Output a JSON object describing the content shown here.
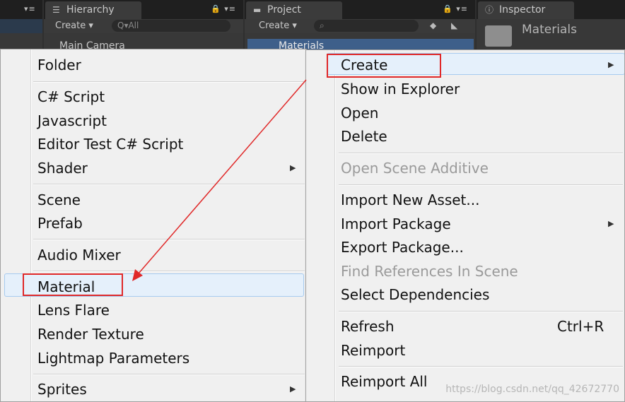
{
  "panels": {
    "hierarchy": {
      "tab": "Hierarchy",
      "create": "Create ▾",
      "search": "Q▾All",
      "visible_item": "Main Camera"
    },
    "project": {
      "tab": "Project",
      "create": "Create ▾",
      "folder": "Materials"
    },
    "inspector": {
      "tab": "Inspector",
      "title": "Materials"
    },
    "lock_menu": "🔒 ▾≡"
  },
  "context_menu": {
    "items": [
      {
        "label": "Create",
        "has_submenu": true,
        "highlighted": true
      },
      {
        "label": "Show in Explorer"
      },
      {
        "label": "Open"
      },
      {
        "label": "Delete"
      },
      {
        "label": "Open Scene Additive",
        "disabled": true
      },
      {
        "label": "Import New Asset..."
      },
      {
        "label": "Import Package",
        "has_submenu": true
      },
      {
        "label": "Export Package..."
      },
      {
        "label": "Find References In Scene",
        "disabled": true
      },
      {
        "label": "Select Dependencies"
      },
      {
        "label": "Refresh",
        "shortcut": "Ctrl+R"
      },
      {
        "label": "Reimport"
      },
      {
        "label": "Reimport All"
      }
    ]
  },
  "create_submenu": {
    "items": [
      {
        "label": "Folder"
      },
      {
        "label": "C# Script"
      },
      {
        "label": "Javascript"
      },
      {
        "label": "Editor Test C# Script"
      },
      {
        "label": "Shader",
        "has_submenu": true
      },
      {
        "label": "Scene"
      },
      {
        "label": "Prefab"
      },
      {
        "label": "Audio Mixer"
      },
      {
        "label": "Material",
        "highlighted": true
      },
      {
        "label": "Lens Flare"
      },
      {
        "label": "Render Texture"
      },
      {
        "label": "Lightmap Parameters"
      },
      {
        "label": "Sprites",
        "has_submenu": true
      }
    ]
  },
  "submenu_arrow": "▶",
  "annotation_color": "#e02828",
  "watermark": "https://blog.csdn.net/qq_42672770"
}
